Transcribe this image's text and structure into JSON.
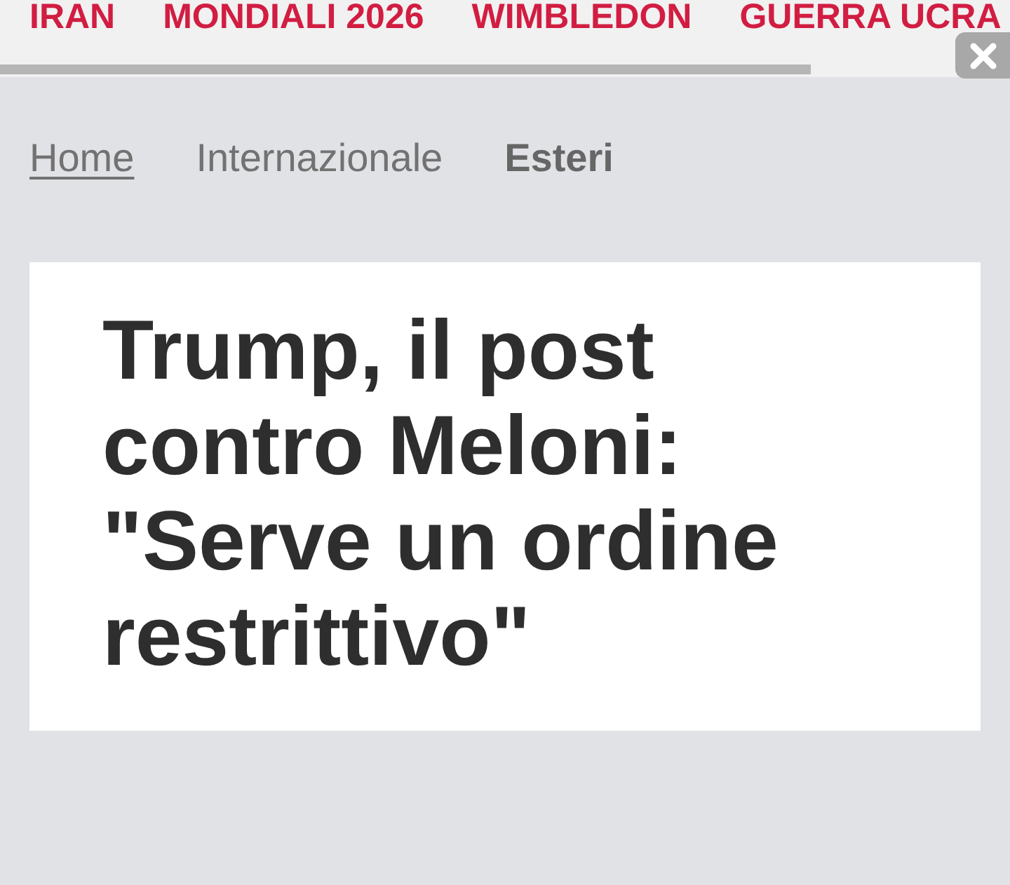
{
  "nav_tags": [
    {
      "label": "IRAN"
    },
    {
      "label": "MONDIALI 2026"
    },
    {
      "label": "WIMBLEDON"
    },
    {
      "label": "GUERRA UCRA"
    }
  ],
  "breadcrumb": [
    {
      "label": "Home",
      "kind": "link"
    },
    {
      "label": "Internazionale",
      "kind": "section"
    },
    {
      "label": "Esteri",
      "kind": "current"
    }
  ],
  "article": {
    "headline": "Trump, il post contro Meloni: \"Serve un ordine restrittivo\""
  }
}
